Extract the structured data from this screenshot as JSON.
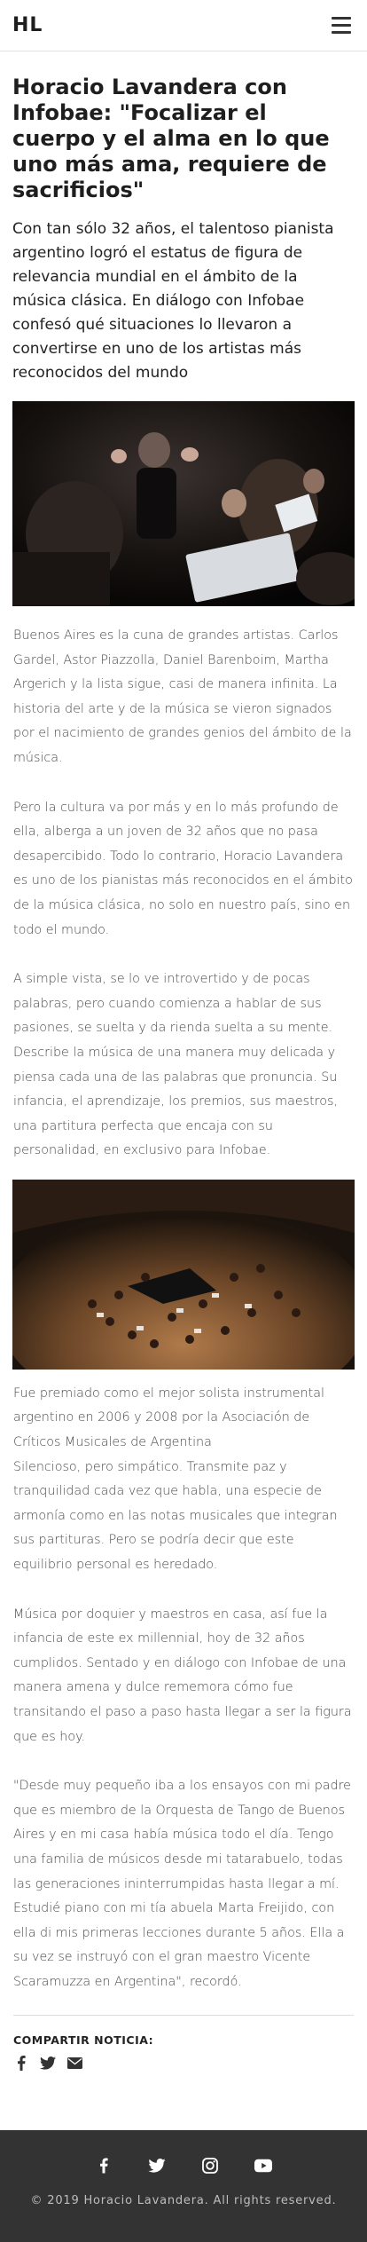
{
  "header": {
    "logo": "HL",
    "menu_icon": "hamburger-icon"
  },
  "article": {
    "title": "Horacio Lavandera con Infobae: \"Focalizar el cuerpo y el alma en lo que uno más ama, requiere de sacrificios\"",
    "lead": "Con tan sólo 32 años, el talentoso pianista argentino logró el estatus de figura de relevancia mundial en el ámbito de la música clásica. En diálogo con Infobae confesó qué situaciones lo llevaron a convertirse en uno de los artistas más reconocidos del mundo",
    "paragraphs": [
      "Buenos Aires es la cuna de grandes artistas. Carlos Gardel, Astor Piazzolla, Daniel Barenboim, Martha Argerich y la lista sigue, casi de manera infinita. La historia del arte y de la música se vieron signados por el nacimiento de grandes genios del ámbito de la música.",
      "Pero la cultura va por más y en lo más profundo de ella, alberga a un joven de 32 años que no pasa desapercibido. Todo lo contrario, Horacio Lavandera es uno de los pianistas más reconocidos en el ámbito de la música clásica, no solo en nuestro país, sino en todo el mundo.",
      "A simple vista, se lo ve introvertido y de pocas palabras, pero cuando comienza a hablar de sus pasiones, se suelta y da rienda suelta a su mente. Describe la música de una manera muy delicada y piensa cada una de las palabras que pronuncia. Su infancia, el aprendizaje, los premios, sus maestros, una partitura perfecta que encaja con su personalidad, en exclusivo para Infobae."
    ],
    "paragraphs_after": [
      "Fue premiado como el mejor solista instrumental argentino en 2006 y 2008 por la Asociación de Críticos Musicales de Argentina\nSilencioso, pero simpático. Transmite paz y tranquilidad cada vez que habla, una especie de armonía como en las notas musicales que integran sus partituras. Pero se podría decir que este equilibrio personal es heredado.",
      "Música por doquier y maestros en casa, así fue la infancia de este ex millennial, hoy de 32 años cumplidos. Sentado y en diálogo con Infobae de una manera amena y dulce rememora cómo fue transitando el paso a paso hasta llegar a ser la figura que es hoy.",
      "\"Desde muy pequeño iba a los ensayos con mi padre que es miembro de la Orquesta de Tango de Buenos Aires y en mi casa había música todo el día. Tengo una familia de músicos desde mi tatarabuelo, todas las generaciones ininterrumpidas hasta llegar a mí. Estudié piano con mi tía abuela Marta Freijido, con ella di mis primeras lecciones durante 5 años. Ella a su vez se instruyó con el gran maestro Vicente Scaramuzza en Argentina\", recordó."
    ]
  },
  "share": {
    "title": "COMPARTIR NOTICIA:",
    "icons": [
      "facebook-icon",
      "twitter-icon",
      "email-icon"
    ]
  },
  "footer": {
    "icons": [
      "facebook-icon",
      "twitter-icon",
      "instagram-icon",
      "youtube-icon"
    ],
    "copyright": "© 2019 Horacio Lavandera. All rights reserved."
  },
  "colors": {
    "footer_bg": "#333333",
    "text": "#4a4a4a",
    "heading": "#1e1e1e"
  }
}
